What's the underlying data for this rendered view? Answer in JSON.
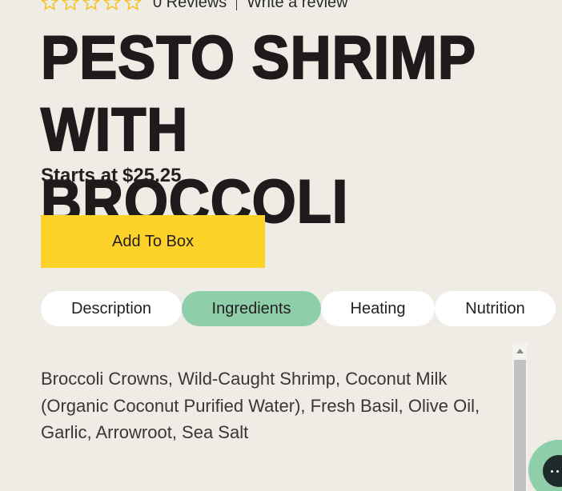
{
  "reviews": {
    "star_count": 5,
    "rating": 0,
    "count_label": "0 Reviews",
    "write_review_label": "Write a review"
  },
  "product": {
    "title": "PESTO SHRIMP WITH BROCCOLI",
    "price_prefix": "Starts at",
    "price_value": "$25.25"
  },
  "actions": {
    "add_to_box_label": "Add To Box"
  },
  "tabs": [
    {
      "label": "Description",
      "active": false
    },
    {
      "label": "Ingredients",
      "active": true
    },
    {
      "label": "Heating",
      "active": false
    },
    {
      "label": "Nutrition",
      "active": false
    }
  ],
  "ingredients": {
    "text": "Broccoli Crowns, Wild-Caught Shrimp, Coconut Milk (Organic Coconut Purified Water), Fresh Basil, Olive Oil, Garlic, Arrowroot, Sea Salt"
  },
  "chat": {
    "icon": "chat-icon"
  },
  "colors": {
    "background": "#efece6",
    "accent_yellow": "#fdd32a",
    "accent_green": "#8ecfaa",
    "star_outline": "#f2c21b",
    "text_dark": "#231f20"
  }
}
